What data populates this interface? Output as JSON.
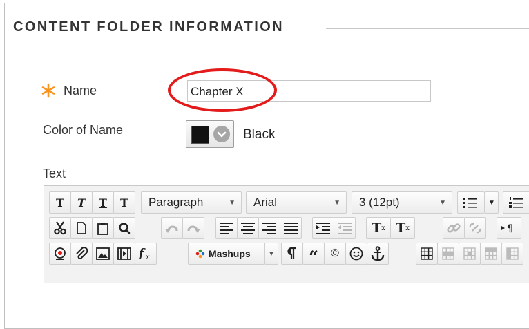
{
  "section": {
    "title": "CONTENT FOLDER INFORMATION"
  },
  "name_field": {
    "label": "Name",
    "value": "Chapter X"
  },
  "color_field": {
    "label": "Color of Name",
    "value": "Black",
    "swatch": "#111111"
  },
  "text_field": {
    "label": "Text"
  },
  "colors": {
    "required": "#f7931e",
    "highlight": "#e31b1b"
  },
  "toolbar": {
    "row1": {
      "bold": "T",
      "italic": "T",
      "underline": "T",
      "strike": "T",
      "format": "Paragraph",
      "font": "Arial",
      "size": "3 (12pt)"
    },
    "row2": {
      "superscript": "T",
      "superscript_mark": "x",
      "clear_format": "T",
      "clear_mark": "x"
    },
    "row3": {
      "mashups": "Mashups",
      "quote": "“",
      "copyright": "©"
    }
  }
}
